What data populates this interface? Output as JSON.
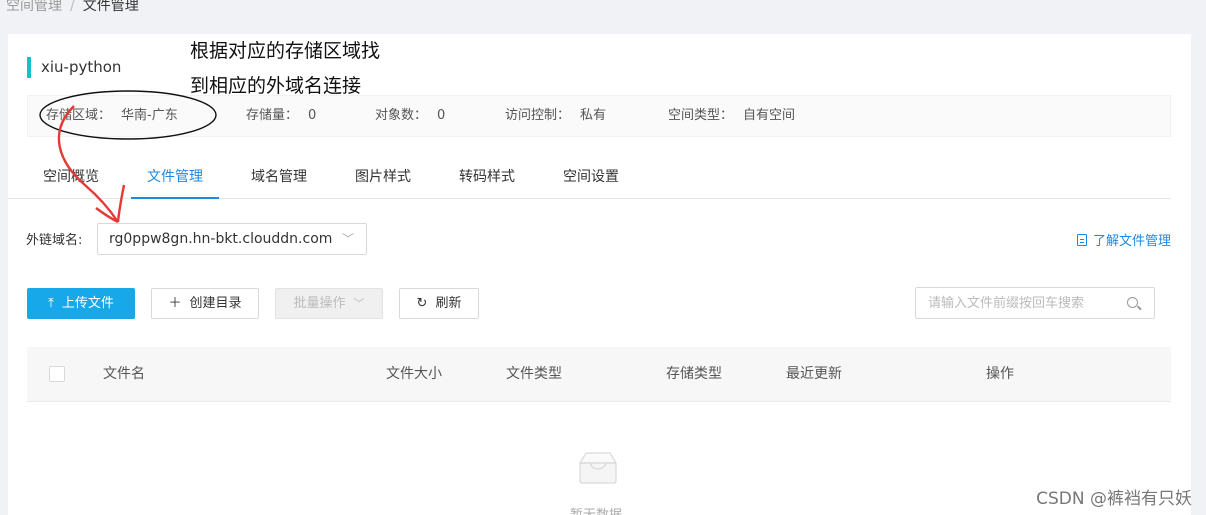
{
  "breadcrumb": {
    "parent": "空间管理",
    "separator": "/",
    "current": "文件管理"
  },
  "bucket": {
    "name": "xiu-python",
    "accent_color": "#13c2c2"
  },
  "annotation": {
    "line1": "根据对应的存储区域找",
    "line2": "到相应的外域名连接",
    "ink_color": "#e53935"
  },
  "info": {
    "region_label": "存储区域：",
    "region_value": "华南-广东",
    "storage_label": "存储量：",
    "storage_value": "0",
    "objects_label": "对象数：",
    "objects_value": "0",
    "access_label": "访问控制：",
    "access_value": "私有",
    "type_label": "空间类型：",
    "type_value": "自有空间"
  },
  "tabs": [
    {
      "label": "空间概览"
    },
    {
      "label": "文件管理",
      "active": true
    },
    {
      "label": "域名管理"
    },
    {
      "label": "图片样式"
    },
    {
      "label": "转码样式"
    },
    {
      "label": "空间设置"
    }
  ],
  "domain": {
    "label": "外链域名:",
    "value": "rg0ppw8gn.hn-bkt.clouddn.com",
    "icon": "chevron-down-icon"
  },
  "help_link": {
    "label": "了解文件管理",
    "icon": "document-icon"
  },
  "toolbar": {
    "upload_label": "上传文件",
    "upload_icon": "upload-icon",
    "mkdir_label": "创建目录",
    "mkdir_icon": "plus-icon",
    "batch_label": "批量操作",
    "batch_icon": "chevron-down-icon",
    "refresh_label": "刷新",
    "refresh_icon": "refresh-icon",
    "primary_color": "#16a8e8"
  },
  "search": {
    "placeholder": "请输入文件前缀按回车搜索",
    "icon": "search-icon"
  },
  "table": {
    "columns": [
      "文件名",
      "文件大小",
      "文件类型",
      "存储类型",
      "最近更新",
      "操作"
    ],
    "empty_text": "暂无数据",
    "empty_icon": "inbox-icon"
  },
  "watermark": "CSDN @裤裆有只妖"
}
